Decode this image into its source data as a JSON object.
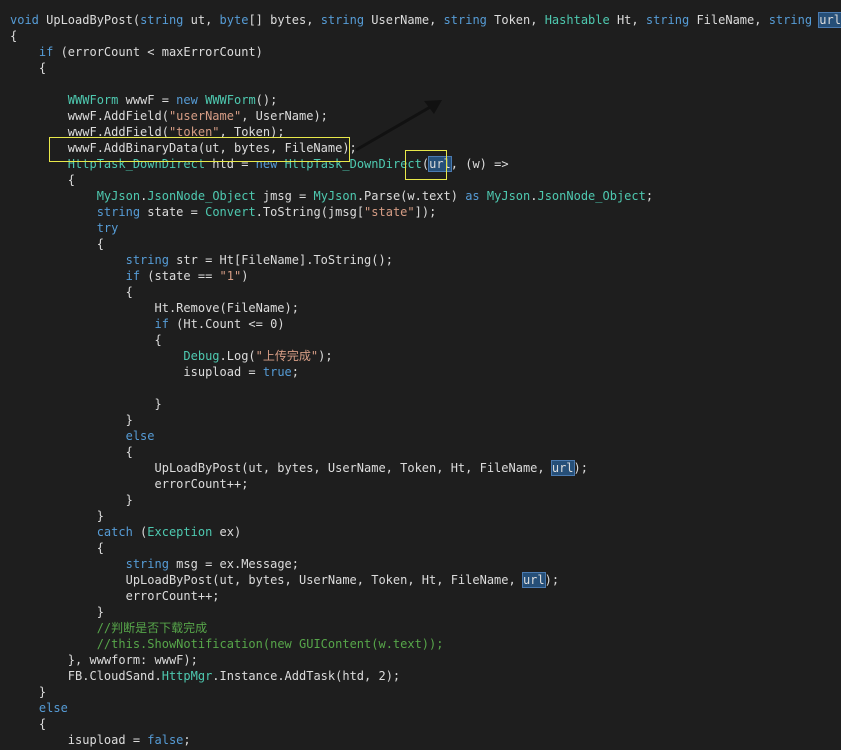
{
  "annotation": {
    "text": "",
    "color": "#c0282a"
  },
  "colors": {
    "background": "#1e1e1e",
    "keyword": "#569cd6",
    "type": "#4ec9b0",
    "string": "#d69d85",
    "comment": "#57a64a",
    "text": "#dcdcdc",
    "highlight": "#264f78",
    "box": "#e8e84a"
  },
  "code_lines": [
    [
      [
        "kw",
        "void"
      ],
      [
        "t",
        " UpLoadByPost("
      ],
      [
        "kw",
        "string"
      ],
      [
        "t",
        " ut, "
      ],
      [
        "kw",
        "byte"
      ],
      [
        "t",
        "[] bytes, "
      ],
      [
        "kw",
        "string"
      ],
      [
        "t",
        " UserName, "
      ],
      [
        "kw",
        "string"
      ],
      [
        "t",
        " Token, "
      ],
      [
        "type",
        "Hashtable"
      ],
      [
        "t",
        " Ht, "
      ],
      [
        "kw",
        "string"
      ],
      [
        "t",
        " FileName, "
      ],
      [
        "kw",
        "string"
      ],
      [
        "t",
        " "
      ],
      [
        "hl",
        "url"
      ],
      [
        "t",
        ")"
      ]
    ],
    [
      [
        "t",
        "{"
      ]
    ],
    [
      [
        "t",
        "    "
      ],
      [
        "kw",
        "if"
      ],
      [
        "t",
        " (errorCount < maxErrorCount)"
      ]
    ],
    [
      [
        "t",
        "    {"
      ]
    ],
    [
      [
        "t",
        ""
      ]
    ],
    [
      [
        "t",
        "        "
      ],
      [
        "type",
        "WWWForm"
      ],
      [
        "t",
        " wwwF = "
      ],
      [
        "kw",
        "new"
      ],
      [
        "t",
        " "
      ],
      [
        "type",
        "WWWForm"
      ],
      [
        "t",
        "();"
      ]
    ],
    [
      [
        "t",
        "        wwwF.AddField("
      ],
      [
        "str",
        "\"userName\""
      ],
      [
        "t",
        ", UserName);"
      ]
    ],
    [
      [
        "t",
        "        wwwF.AddField("
      ],
      [
        "str",
        "\"token\""
      ],
      [
        "t",
        ", Token);"
      ]
    ],
    [
      [
        "t",
        "        wwwF.AddBinaryData(ut, bytes, FileName);"
      ]
    ],
    [
      [
        "t",
        "        "
      ],
      [
        "type",
        "HttpTask_DownDirect"
      ],
      [
        "t",
        " htd = "
      ],
      [
        "kw",
        "new"
      ],
      [
        "t",
        " "
      ],
      [
        "type",
        "HttpTask_DownDirect"
      ],
      [
        "t",
        "("
      ],
      [
        "hl",
        "url"
      ],
      [
        "t",
        ", (w) =>"
      ]
    ],
    [
      [
        "t",
        "        {"
      ]
    ],
    [
      [
        "t",
        "            "
      ],
      [
        "type",
        "MyJson"
      ],
      [
        "t",
        "."
      ],
      [
        "type",
        "JsonNode_Object"
      ],
      [
        "t",
        " jmsg = "
      ],
      [
        "type",
        "MyJson"
      ],
      [
        "t",
        ".Parse(w.text) "
      ],
      [
        "kw",
        "as"
      ],
      [
        "t",
        " "
      ],
      [
        "type",
        "MyJson"
      ],
      [
        "t",
        "."
      ],
      [
        "type",
        "JsonNode_Object"
      ],
      [
        "t",
        ";"
      ]
    ],
    [
      [
        "t",
        "            "
      ],
      [
        "kw",
        "string"
      ],
      [
        "t",
        " state = "
      ],
      [
        "type",
        "Convert"
      ],
      [
        "t",
        ".ToString(jmsg["
      ],
      [
        "str",
        "\"state\""
      ],
      [
        "t",
        "]);"
      ]
    ],
    [
      [
        "t",
        "            "
      ],
      [
        "kw",
        "try"
      ]
    ],
    [
      [
        "t",
        "            {"
      ]
    ],
    [
      [
        "t",
        "                "
      ],
      [
        "kw",
        "string"
      ],
      [
        "t",
        " str = Ht[FileName].ToString();"
      ]
    ],
    [
      [
        "t",
        "                "
      ],
      [
        "kw",
        "if"
      ],
      [
        "t",
        " (state == "
      ],
      [
        "str",
        "\"1\""
      ],
      [
        "t",
        ")"
      ]
    ],
    [
      [
        "t",
        "                {"
      ]
    ],
    [
      [
        "t",
        "                    Ht.Remove(FileName);"
      ]
    ],
    [
      [
        "t",
        "                    "
      ],
      [
        "kw",
        "if"
      ],
      [
        "t",
        " (Ht.Count <= 0)"
      ]
    ],
    [
      [
        "t",
        "                    {"
      ]
    ],
    [
      [
        "t",
        "                        "
      ],
      [
        "type",
        "Debug"
      ],
      [
        "t",
        ".Log("
      ],
      [
        "str",
        "\"上传完成\""
      ],
      [
        "t",
        ");"
      ]
    ],
    [
      [
        "t",
        "                        isupload = "
      ],
      [
        "kw",
        "true"
      ],
      [
        "t",
        ";"
      ]
    ],
    [
      [
        "t",
        ""
      ]
    ],
    [
      [
        "t",
        "                    }"
      ]
    ],
    [
      [
        "t",
        "                }"
      ]
    ],
    [
      [
        "t",
        "                "
      ],
      [
        "kw",
        "else"
      ]
    ],
    [
      [
        "t",
        "                {"
      ]
    ],
    [
      [
        "t",
        "                    UpLoadByPost(ut, bytes, UserName, Token, Ht, FileName, "
      ],
      [
        "hl",
        "url"
      ],
      [
        "t",
        ");"
      ]
    ],
    [
      [
        "t",
        "                    errorCount++;"
      ]
    ],
    [
      [
        "t",
        "                }"
      ]
    ],
    [
      [
        "t",
        "            }"
      ]
    ],
    [
      [
        "t",
        "            "
      ],
      [
        "kw",
        "catch"
      ],
      [
        "t",
        " ("
      ],
      [
        "type",
        "Exception"
      ],
      [
        "t",
        " ex)"
      ]
    ],
    [
      [
        "t",
        "            {"
      ]
    ],
    [
      [
        "t",
        "                "
      ],
      [
        "kw",
        "string"
      ],
      [
        "t",
        " msg = ex.Message;"
      ]
    ],
    [
      [
        "t",
        "                UpLoadByPost(ut, bytes, UserName, Token, Ht, FileName, "
      ],
      [
        "hl",
        "url"
      ],
      [
        "t",
        ");"
      ]
    ],
    [
      [
        "t",
        "                errorCount++;"
      ]
    ],
    [
      [
        "t",
        "            }"
      ]
    ],
    [
      [
        "t",
        "            "
      ],
      [
        "cmt",
        "//判断是否下载完成"
      ]
    ],
    [
      [
        "t",
        "            "
      ],
      [
        "cmt",
        "//this.ShowNotification(new GUIContent(w.text));"
      ]
    ],
    [
      [
        "t",
        "        }, wwwform: wwwF);"
      ]
    ],
    [
      [
        "t",
        "        FB.CloudSand."
      ],
      [
        "type",
        "HttpMgr"
      ],
      [
        "t",
        ".Instance.AddTask(htd, 2);"
      ]
    ],
    [
      [
        "t",
        "    }"
      ]
    ],
    [
      [
        "t",
        "    "
      ],
      [
        "kw",
        "else"
      ]
    ],
    [
      [
        "t",
        "    {"
      ]
    ],
    [
      [
        "t",
        "        isupload = "
      ],
      [
        "kw",
        "false"
      ],
      [
        "t",
        ";"
      ]
    ]
  ]
}
